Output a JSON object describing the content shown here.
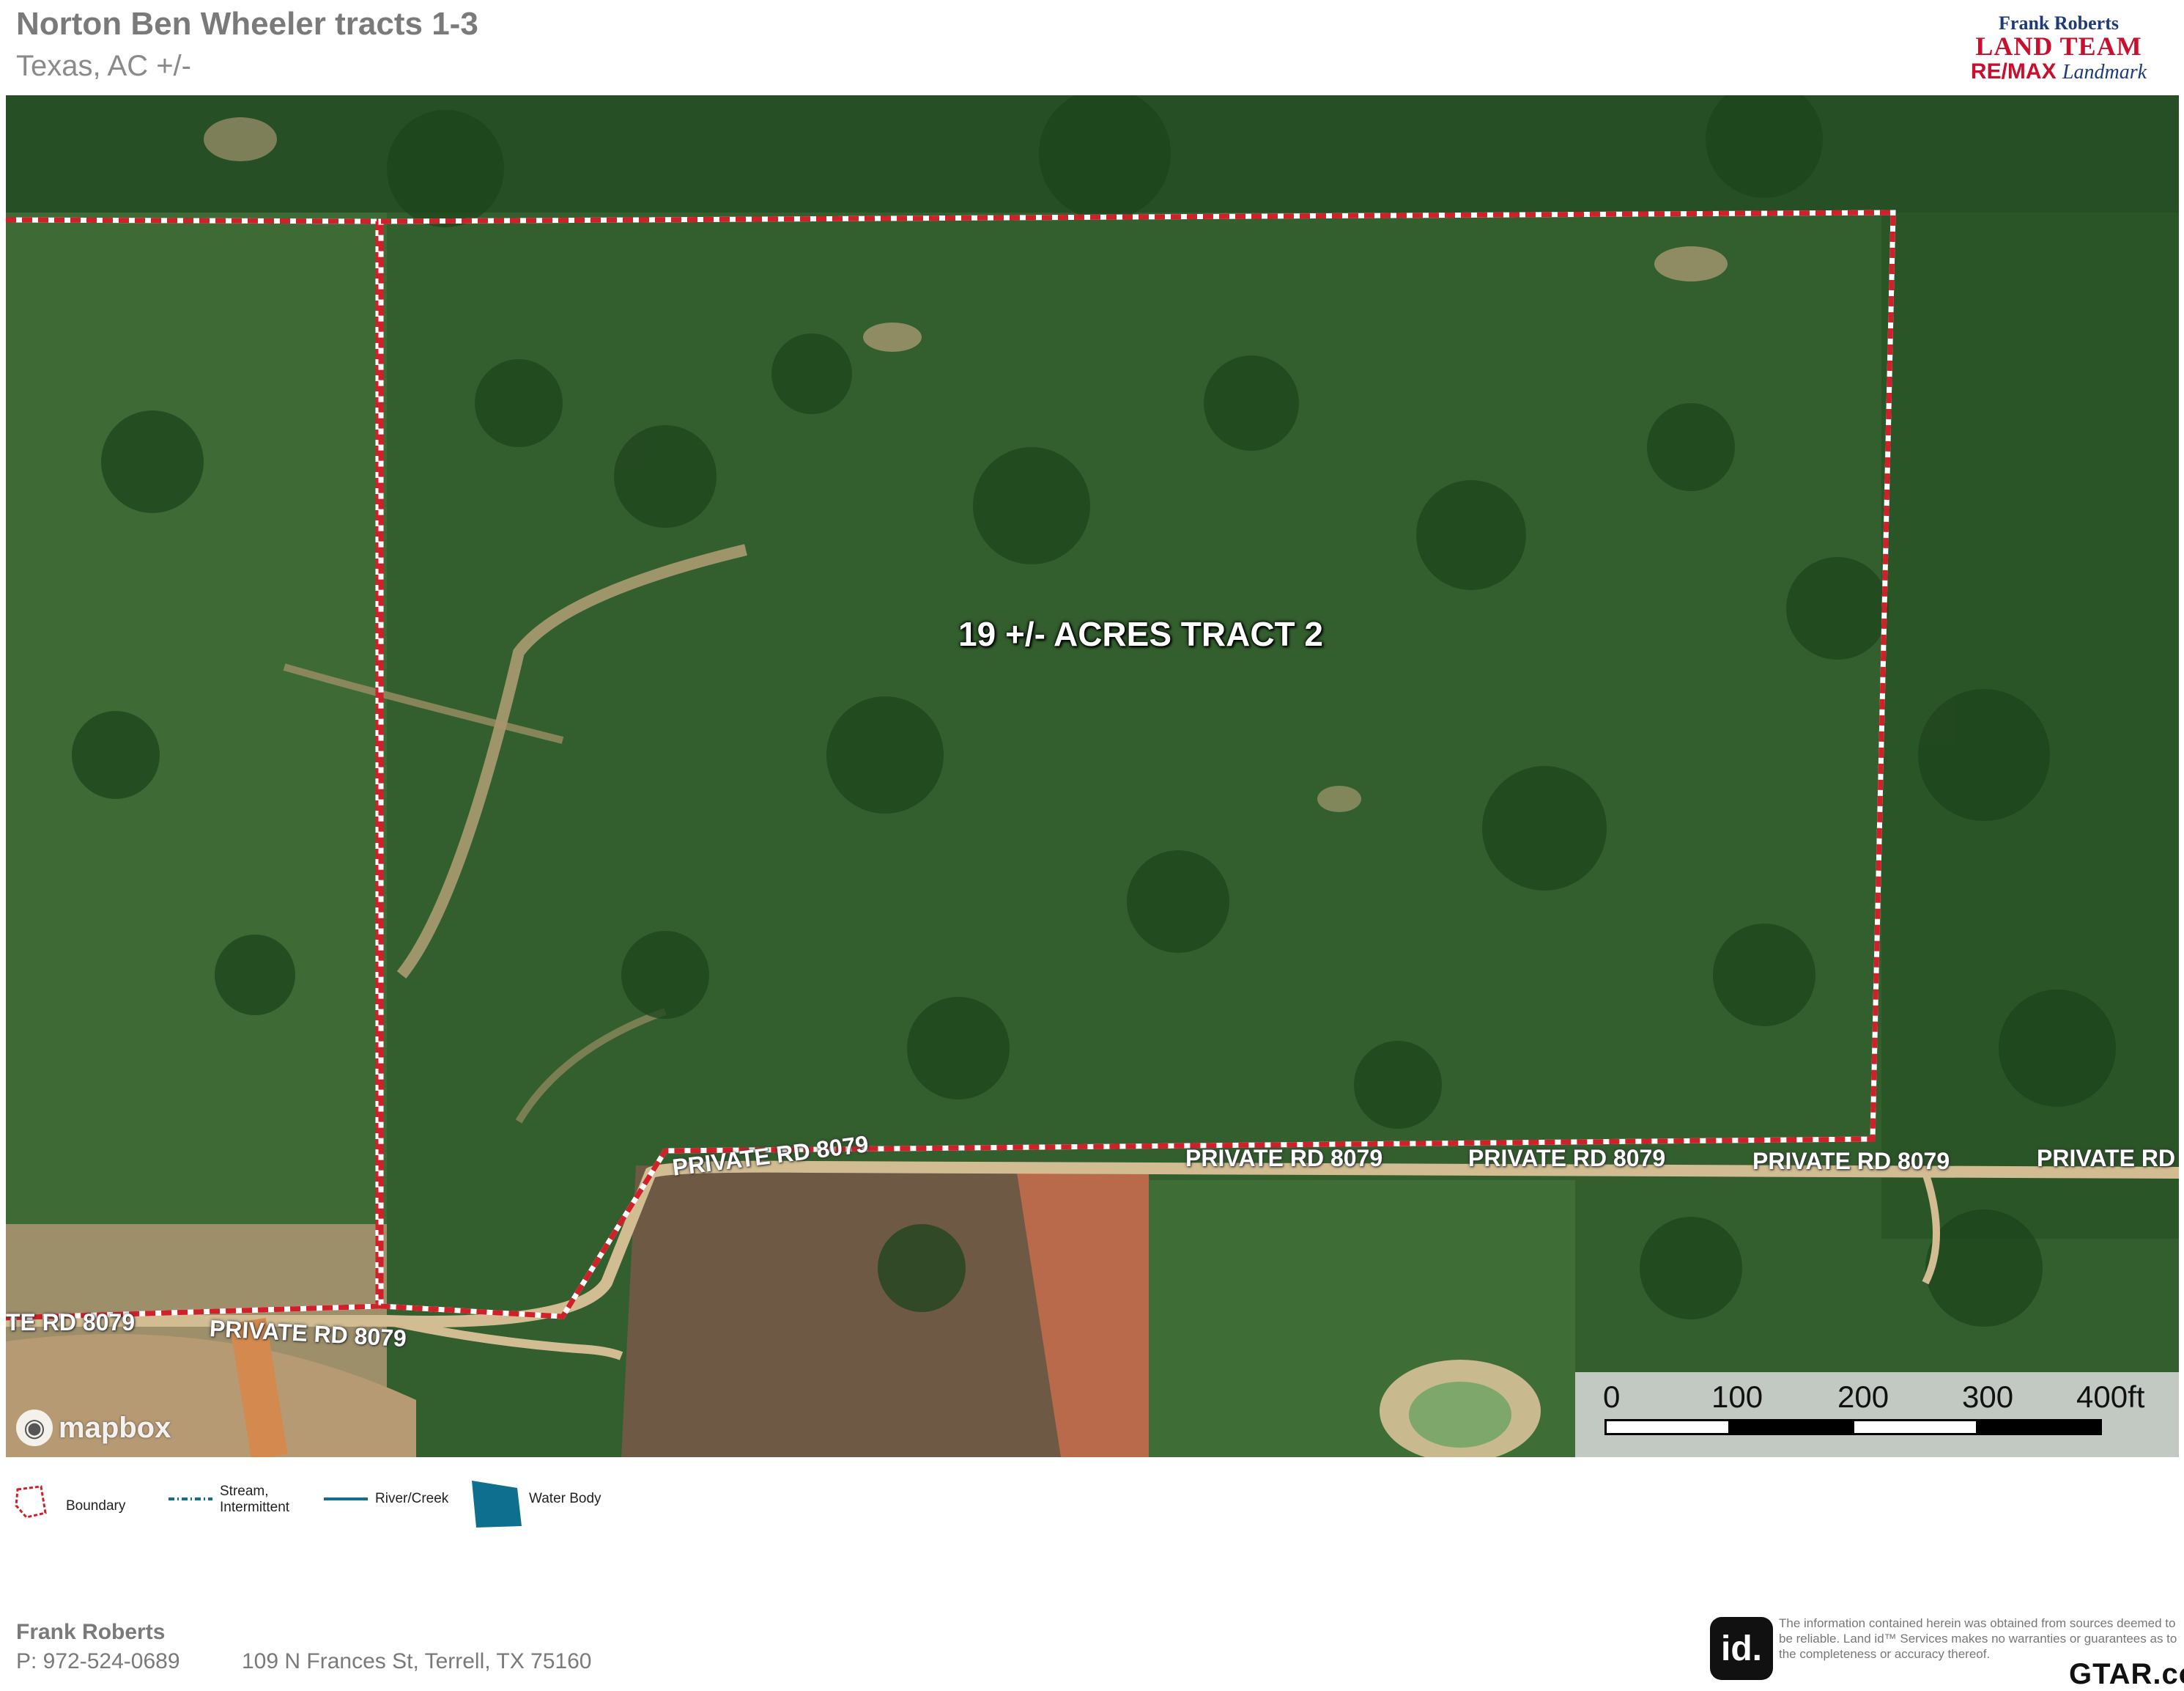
{
  "header": {
    "title": "Norton Ben Wheeler tracts 1-3",
    "subtitle": "Texas,  AC +/-"
  },
  "logo": {
    "line1": "Frank Roberts",
    "line2": "LAND TEAM",
    "line3_brand": "RE/MAX",
    "line3_script": "Landmark"
  },
  "map": {
    "tract_label": "19 +/- ACRES TRACT 2",
    "road_labels": [
      "PRIVATE RD 8079",
      "PRIVATE RD 8079",
      "PRIVATE RD 8079",
      "PRIVATE RD 8079",
      "PRIVATE RD",
      "TE RD 8079",
      "PRIVATE RD 8079"
    ],
    "attribution": "mapbox",
    "boundary_color": "#d0202a"
  },
  "scale_bar": {
    "ticks": [
      "0",
      "100",
      "200",
      "300",
      "400ft"
    ]
  },
  "legend": {
    "boundary": "Boundary",
    "stream_line1": "Stream,",
    "stream_line2": "Intermittent",
    "river": "River/Creek",
    "water_body": "Water Body",
    "water_color": "#0e6f8f"
  },
  "footer": {
    "name": "Frank Roberts",
    "phone": "P: 972-524-0689",
    "address": "109 N Frances St, Terrell, TX 75160",
    "id_logo": "id.",
    "disclaimer": "The information contained herein was obtained from sources deemed to be reliable. Land id™ Services makes no warranties or guarantees as to the completeness or accuracy thereof.",
    "gtar": "GTAR.com"
  }
}
